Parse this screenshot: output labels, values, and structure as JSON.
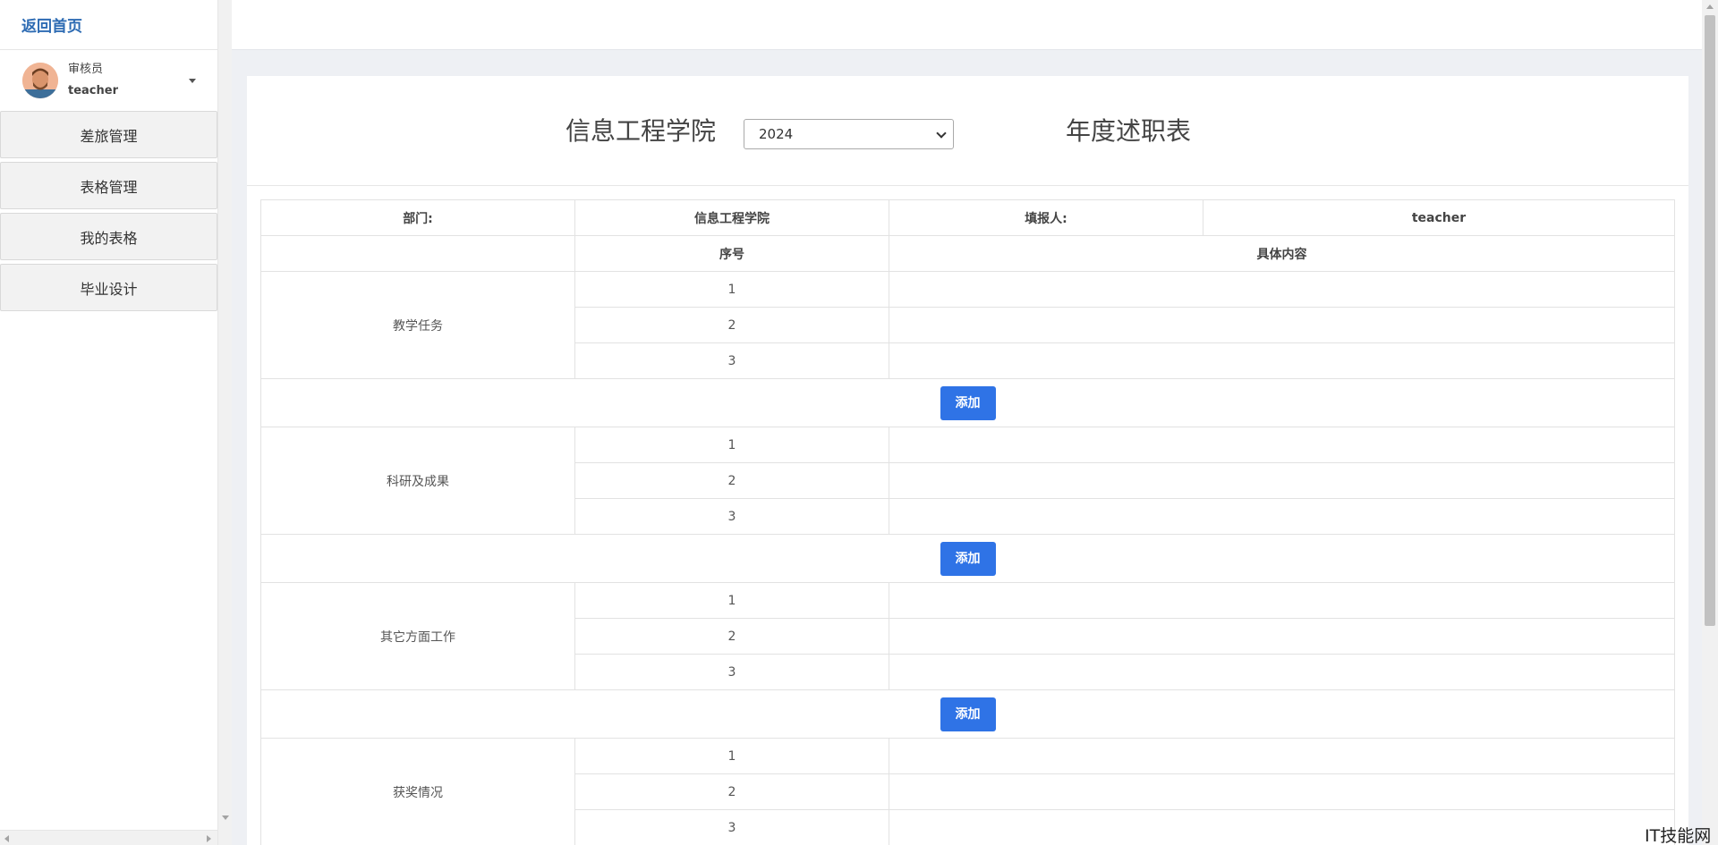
{
  "sidebar": {
    "back_home": "返回首页",
    "user": {
      "role": "审核员",
      "name": "teacher"
    },
    "menu": [
      "差旅管理",
      "表格管理",
      "我的表格",
      "毕业设计"
    ]
  },
  "form": {
    "college_title": "信息工程学院",
    "year": "2024",
    "report_title": "年度述职表",
    "dept_label": "部门:",
    "dept_value": "信息工程学院",
    "reporter_label": "填报人:",
    "reporter_value": "teacher",
    "col_index": "序号",
    "col_content": "具体内容",
    "add_label": "添加",
    "sections": [
      {
        "name": "教学任务",
        "rows": [
          "1",
          "2",
          "3"
        ]
      },
      {
        "name": "科研及成果",
        "rows": [
          "1",
          "2",
          "3"
        ]
      },
      {
        "name": "其它方面工作",
        "rows": [
          "1",
          "2",
          "3"
        ]
      },
      {
        "name": "获奖情况",
        "rows": [
          "1",
          "2",
          "3"
        ]
      }
    ]
  },
  "watermark": "IT技能网",
  "colors": {
    "accent": "#2f73e6",
    "link": "#2d6bb3"
  }
}
